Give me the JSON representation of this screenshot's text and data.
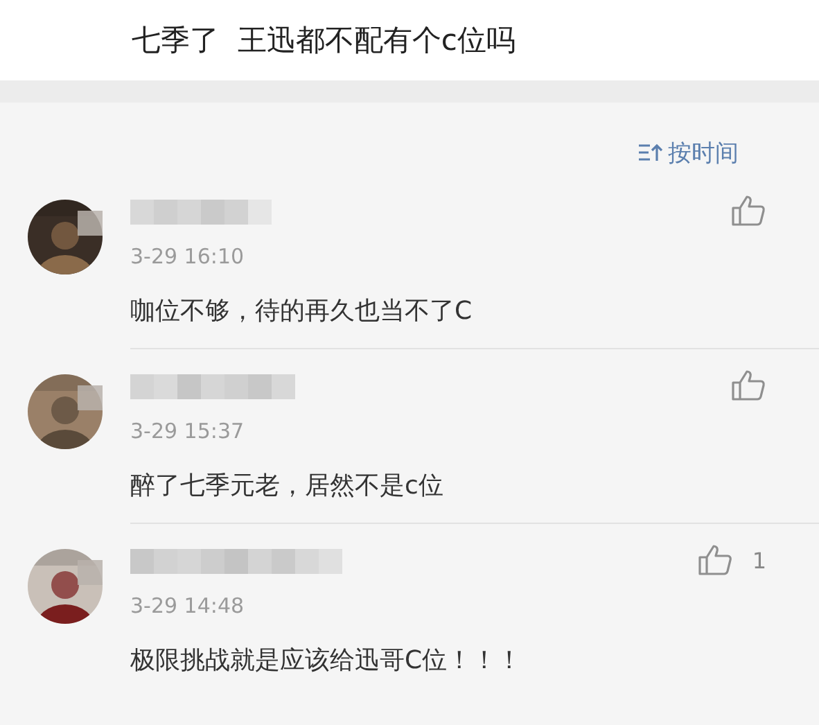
{
  "header": {
    "title": "七季了  王迅都不配有个c位吗"
  },
  "sort": {
    "label": "按时间"
  },
  "comments": [
    {
      "time": "3-29 16:10",
      "text": "咖位不够，待的再久也当不了C"
    },
    {
      "time": "3-29 15:37",
      "text": "醉了七季元老，居然不是c位"
    },
    {
      "time": "3-29 14:48",
      "text": "极限挑战就是应该给迅哥C位！！！",
      "likes": "1"
    }
  ]
}
